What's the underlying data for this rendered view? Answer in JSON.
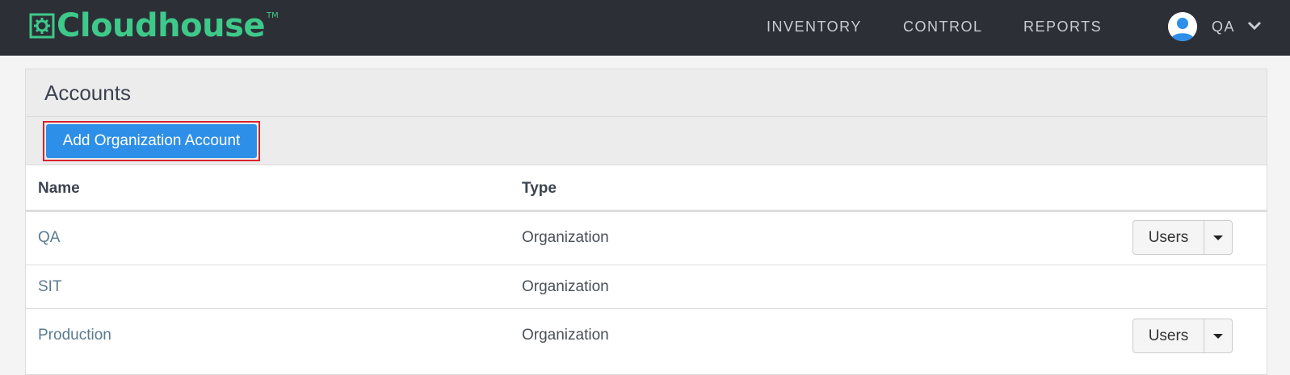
{
  "brand": {
    "name": "Cloudhouse",
    "trademark": "TM",
    "color": "#3ec98a"
  },
  "nav": {
    "items": [
      {
        "label": "INVENTORY"
      },
      {
        "label": "CONTROL"
      },
      {
        "label": "REPORTS"
      }
    ],
    "user": {
      "name": "QA",
      "icon": "user-avatar-icon"
    }
  },
  "accounts": {
    "title": "Accounts",
    "add_button_label": "Add Organization Account",
    "columns": {
      "name": "Name",
      "type": "Type"
    },
    "rows": [
      {
        "name": "QA",
        "type": "Organization",
        "action": "Users"
      },
      {
        "name": "SIT",
        "type": "Organization",
        "action": ""
      },
      {
        "name": "Production",
        "type": "Organization",
        "action": "Users"
      }
    ]
  },
  "colors": {
    "navbar": "#2c3036",
    "primary_button": "#2d8fe8",
    "highlight_outline": "#d9232d"
  }
}
